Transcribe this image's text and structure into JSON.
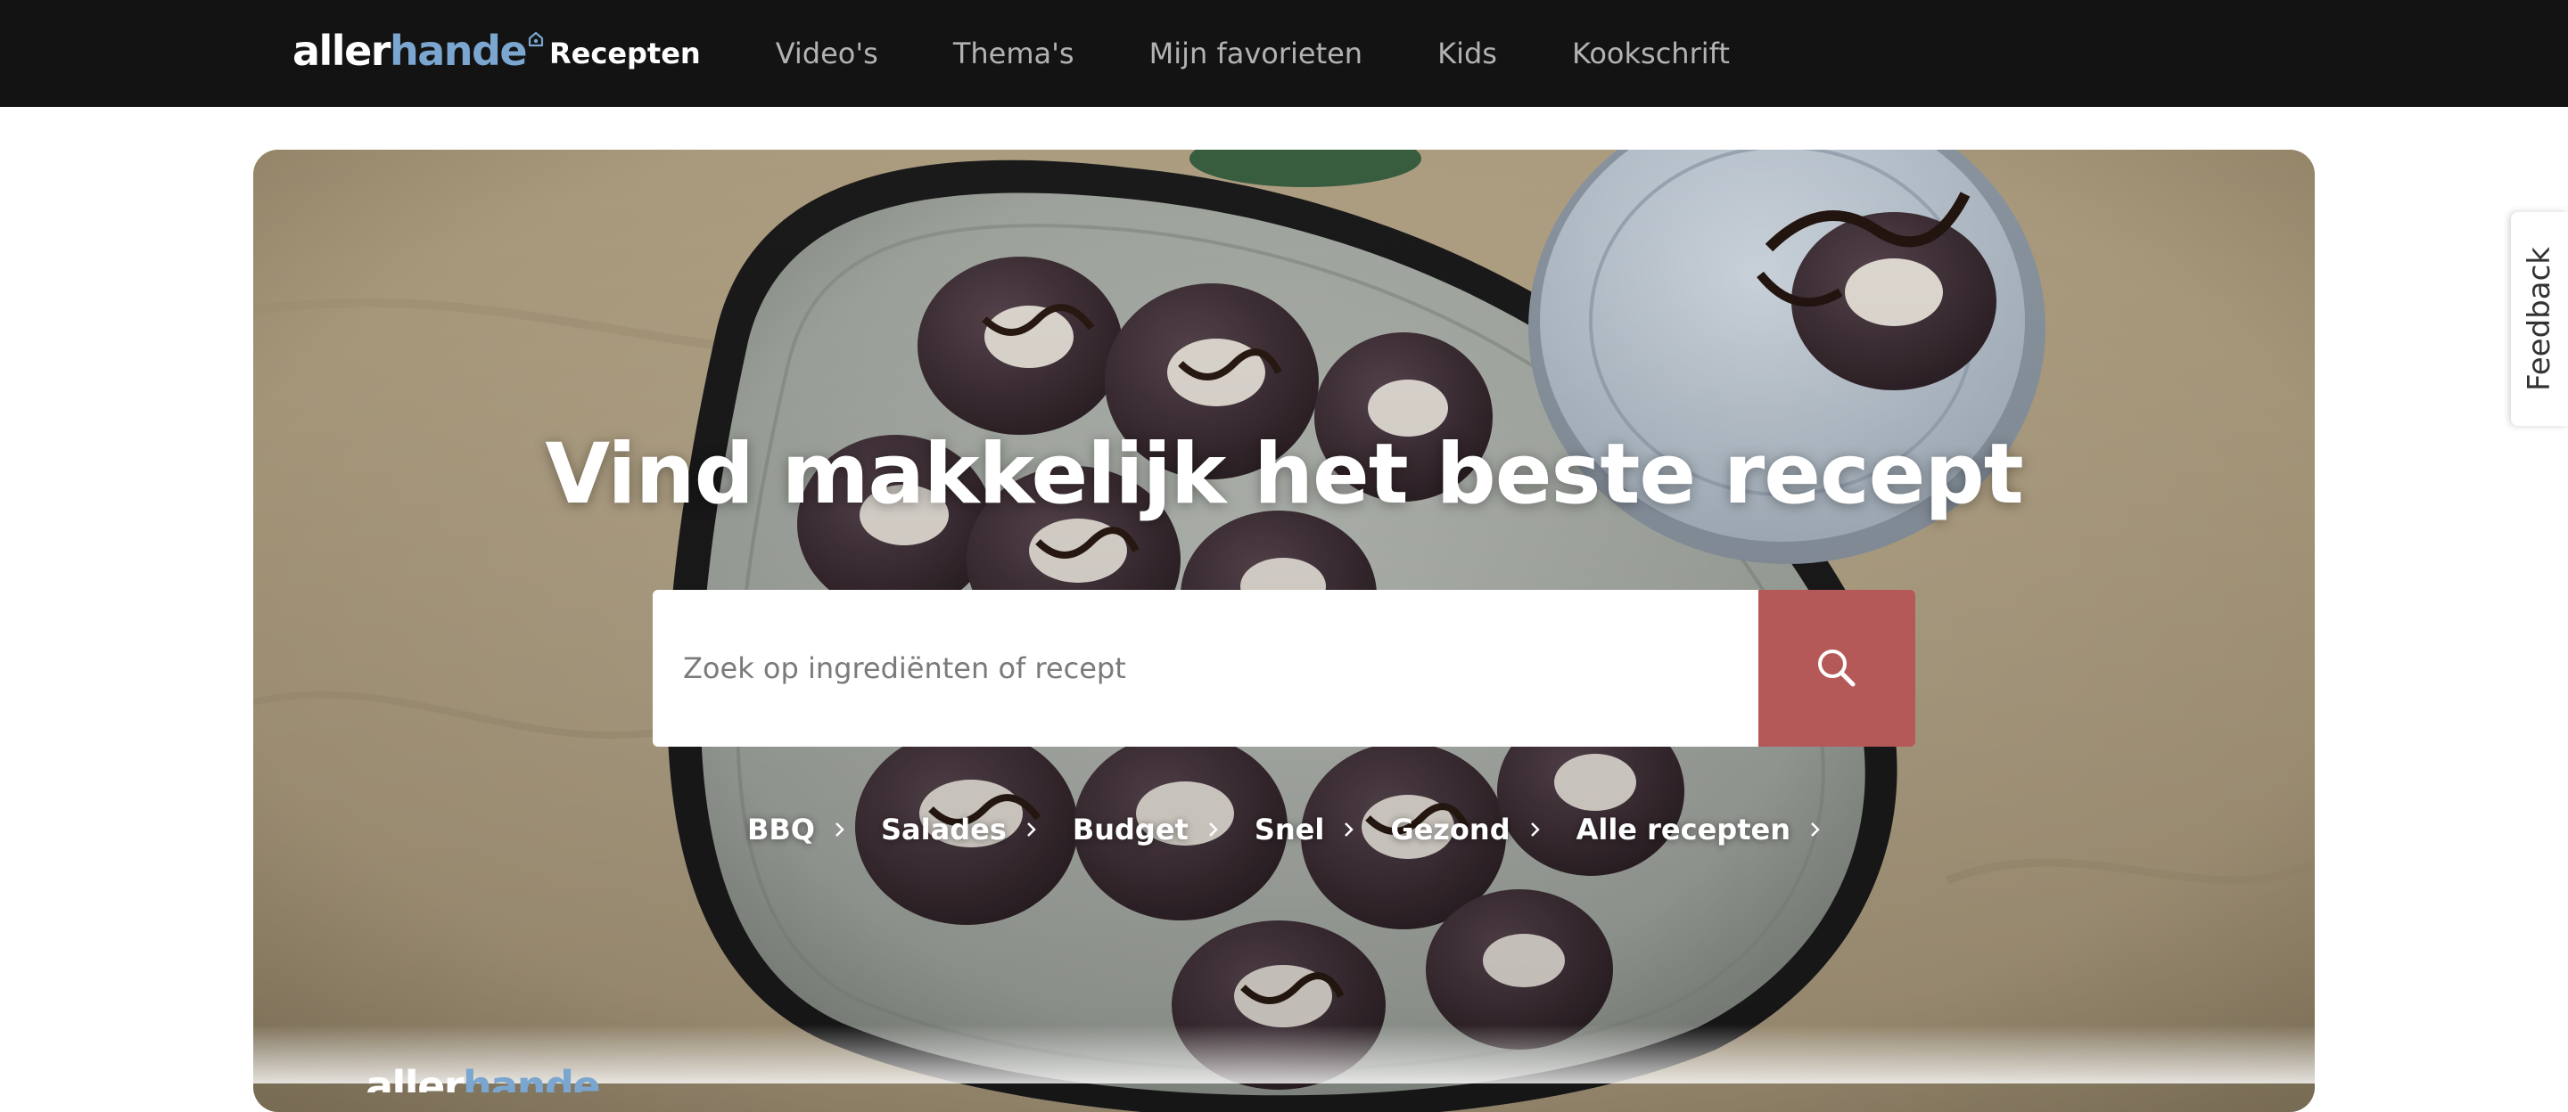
{
  "brand": {
    "logo_part1": "aller",
    "logo_part2": "hande",
    "logo_colors": {
      "part1": "#ffffff",
      "part2": "#7aa6cf"
    }
  },
  "nav": {
    "items": [
      {
        "label": "Recepten",
        "active": true
      },
      {
        "label": "Video's",
        "active": false
      },
      {
        "label": "Thema's",
        "active": false
      },
      {
        "label": "Mijn favorieten",
        "active": false
      },
      {
        "label": "Kids",
        "active": false
      },
      {
        "label": "Kookschrift",
        "active": false
      }
    ]
  },
  "hero": {
    "title": "Vind makkelijk het beste recept",
    "search": {
      "placeholder": "Zoek op ingrediënten of recept",
      "value": "",
      "button_icon": "search-icon",
      "button_color": "#b55858"
    },
    "quick_links": [
      {
        "label": "BBQ"
      },
      {
        "label": "Salades"
      },
      {
        "label": "Budget"
      },
      {
        "label": "Snel"
      },
      {
        "label": "Gezond"
      },
      {
        "label": "Alle recepten"
      }
    ]
  },
  "feedback": {
    "label": "Feedback"
  },
  "colors": {
    "nav_bg": "#131313",
    "accent": "#b55858"
  }
}
